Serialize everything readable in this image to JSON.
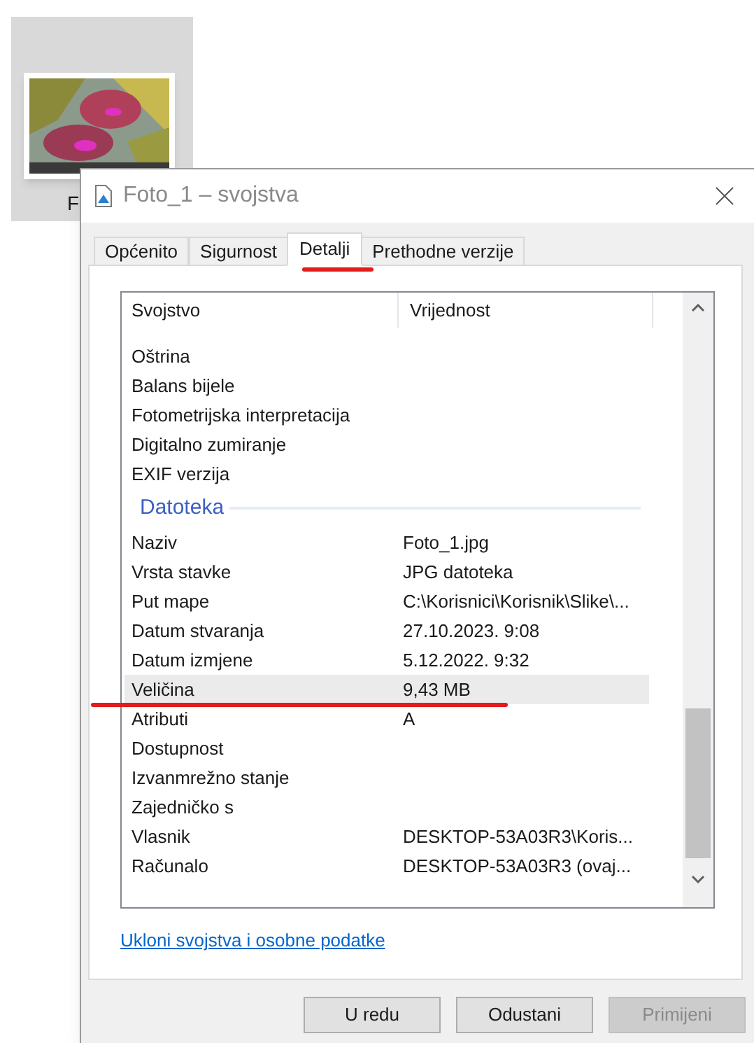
{
  "desktop_icon": {
    "label": "F"
  },
  "window": {
    "title": "Foto_1 – svojstva"
  },
  "tabs": [
    {
      "label": "Općenito",
      "selected": false
    },
    {
      "label": "Sigurnost",
      "selected": false
    },
    {
      "label": "Detalji",
      "selected": true
    },
    {
      "label": "Prethodne verzije",
      "selected": false
    }
  ],
  "table": {
    "columns": [
      "Svojstvo",
      "Vrijednost"
    ],
    "rows": [
      {
        "kind": "property",
        "name": "Oštrina",
        "selected": false
      },
      {
        "kind": "property",
        "name": "Balans bijele",
        "selected": false
      },
      {
        "kind": "property",
        "name": "Fotometrijska interpretacija",
        "selected": false
      },
      {
        "kind": "property",
        "name": "Digitalno zumiranje",
        "selected": false
      },
      {
        "kind": "property",
        "name": "EXIF verzija",
        "selected": false
      },
      {
        "kind": "group",
        "name": "Datoteka"
      },
      {
        "kind": "property",
        "name": "Naziv",
        "value": "Foto_1.jpg",
        "selected": false
      },
      {
        "kind": "property",
        "name": "Vrsta stavke",
        "value": "JPG datoteka",
        "selected": false
      },
      {
        "kind": "property",
        "name": "Put mape",
        "value": "C:\\Korisnici\\Korisnik\\Slike\\...",
        "selected": false
      },
      {
        "kind": "property",
        "name": "Datum stvaranja",
        "value": "27.10.2023. 9:08",
        "selected": false
      },
      {
        "kind": "property",
        "name": "Datum izmjene",
        "value": "5.12.2022. 9:32",
        "selected": false
      },
      {
        "kind": "property",
        "name": "Veličina",
        "value": "9,43 MB",
        "selected": true
      },
      {
        "kind": "property",
        "name": "Atributi",
        "value": "A",
        "selected": false
      },
      {
        "kind": "property",
        "name": "Dostupnost",
        "selected": false
      },
      {
        "kind": "property",
        "name": "Izvanmrežno stanje",
        "selected": false
      },
      {
        "kind": "property",
        "name": "Zajedničko s",
        "selected": false
      },
      {
        "kind": "property",
        "name": "Vlasnik",
        "value": "DESKTOP-53A03R3\\Koris...",
        "selected": false
      },
      {
        "kind": "property",
        "name": "Računalo",
        "value": "DESKTOP-53A03R3 (ovaj...",
        "selected": false
      }
    ]
  },
  "link": "Ukloni svojstva i osobne podatke",
  "buttons": [
    {
      "label": "U redu",
      "disabled": false
    },
    {
      "label": "Odustani",
      "disabled": false
    },
    {
      "label": "Primijeni",
      "disabled": true
    }
  ]
}
